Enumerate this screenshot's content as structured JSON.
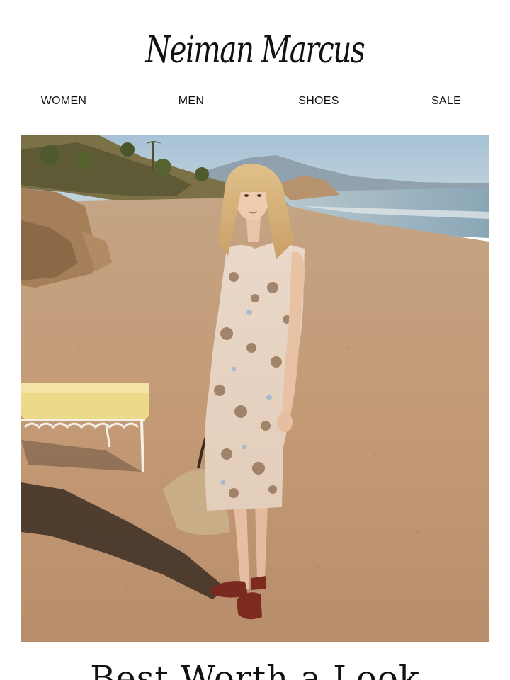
{
  "brand": {
    "logo_text": "Neiman Marcus"
  },
  "nav": {
    "items": [
      {
        "label": "WOMEN"
      },
      {
        "label": "MEN"
      },
      {
        "label": "SHOES"
      },
      {
        "label": "SALE"
      }
    ]
  },
  "hero": {
    "description_icon": "beach-fashion-photo"
  },
  "headline": {
    "text": "Best Worth a Look"
  },
  "colors": {
    "sky": "#a9c4d6",
    "sand": "#c9a27f",
    "sea": "#9fb6c2",
    "text": "#111111"
  }
}
